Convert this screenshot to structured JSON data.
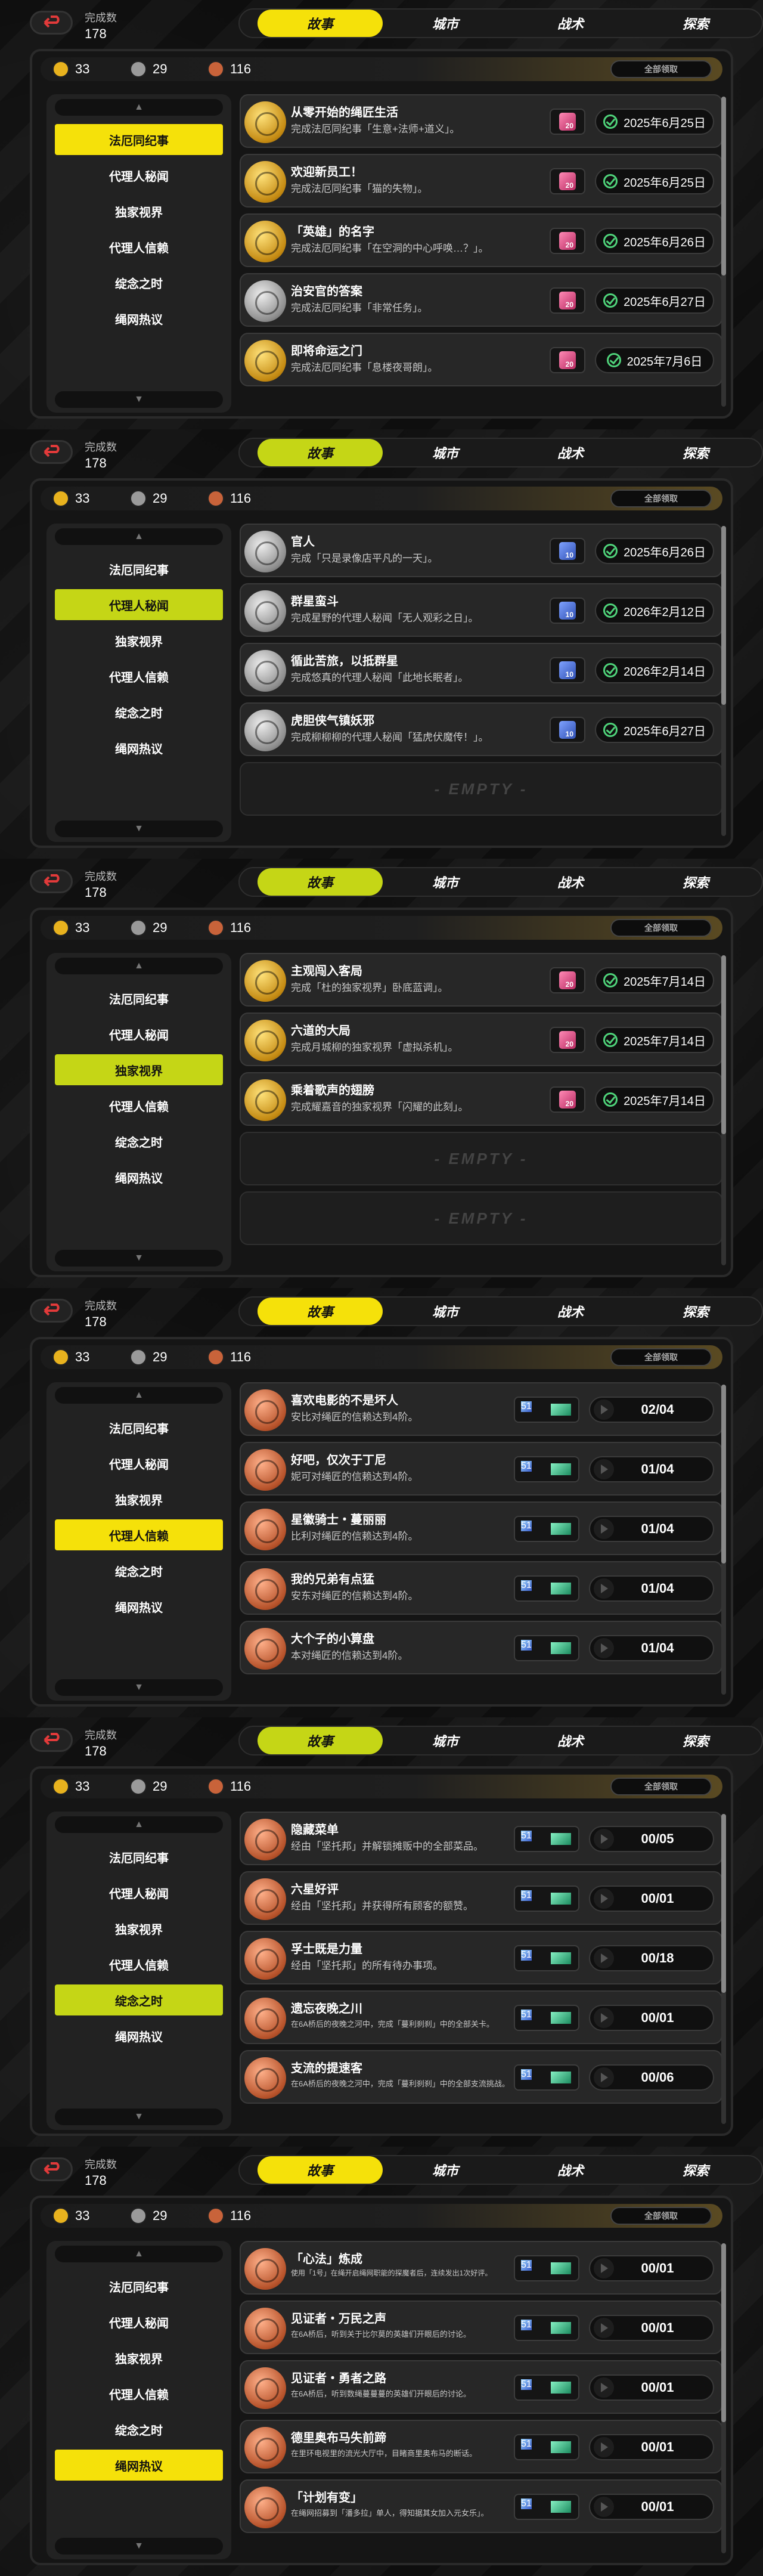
{
  "accent": "#f5e10a",
  "accent_alt": "#c5d616",
  "completion": {
    "label": "完成数",
    "value": "178"
  },
  "tabs": [
    "故事",
    "城市",
    "战术",
    "探索"
  ],
  "currencies": [
    {
      "icon": "gold-coin-icon",
      "value": "33",
      "color": "#e8b21e"
    },
    {
      "icon": "silver-coin-icon",
      "value": "29",
      "color": "#9a9a9a"
    },
    {
      "icon": "bronze-coin-icon",
      "value": "116",
      "color": "#c8633a"
    }
  ],
  "claim_all": "全部领取",
  "categories": [
    "法厄同纪事",
    "代理人秘闻",
    "独家视界",
    "代理人信赖",
    "绽念之时",
    "绳网热议"
  ],
  "empty_label": "- EMPTY -",
  "panels": [
    {
      "active_category": 0,
      "rows": [
        {
          "title": "从零开始的绳匠生活",
          "desc": "完成法厄同纪事「生意+法师+道义」。",
          "badge": "gold",
          "reward": "20",
          "chip": "pink",
          "status": "2025年6月25日"
        },
        {
          "title": "欢迎新员工！",
          "desc": "完成法厄同纪事「猫的失物」。",
          "badge": "gold",
          "reward": "20",
          "chip": "pink",
          "status": "2025年6月25日"
        },
        {
          "title": "「英雄」的名字",
          "desc": "完成法厄同纪事「在空洞的中心呼唤…？」。",
          "badge": "gold",
          "reward": "20",
          "chip": "pink",
          "status": "2025年6月26日"
        },
        {
          "title": "治安官的答案",
          "desc": "完成法厄同纪事「非常任务」。",
          "badge": "silver",
          "reward": "20",
          "chip": "pink",
          "status": "2025年6月27日"
        },
        {
          "title": "即将命运之门",
          "desc": "完成法厄同纪事「息楼夜哥朗」。",
          "badge": "gold",
          "reward": "20",
          "chip": "pink",
          "status": "2025年7月6日"
        }
      ]
    },
    {
      "active_category": 1,
      "rows": [
        {
          "title": "官人",
          "desc": "完成「只是录像店平凡的一天」。",
          "badge": "silver",
          "reward": "10",
          "chip": "blue",
          "status": "2025年6月26日"
        },
        {
          "title": "群星蛮斗",
          "desc": "完成星野的代理人秘闻「无人观彩之日」。",
          "badge": "silver",
          "reward": "10",
          "chip": "blue",
          "status": "2026年2月12日"
        },
        {
          "title": "循此苦旅，以抵群星",
          "desc": "完成悠真的代理人秘闻「此地长眠者」。",
          "badge": "silver",
          "reward": "10",
          "chip": "blue",
          "status": "2026年2月14日"
        },
        {
          "title": "虎胆侠气镇妖邪",
          "desc": "完成柳柳柳的代理人秘闻「猛虎伏魔传！」。",
          "badge": "silver",
          "reward": "10",
          "chip": "blue",
          "status": "2025年6月27日"
        }
      ],
      "empties": 1
    },
    {
      "active_category": 2,
      "rows": [
        {
          "title": "主观闯入客局",
          "desc": "完成「杜的独家视界」卧底蓝调」。",
          "badge": "gold",
          "reward": "20",
          "chip": "pink",
          "status": "2025年7月14日"
        },
        {
          "title": "六道的大局",
          "desc": "完成月城柳的独家视界「虚拟杀机」。",
          "badge": "gold",
          "reward": "20",
          "chip": "pink",
          "status": "2025年7月14日"
        },
        {
          "title": "乘着歌声的翅膀",
          "desc": "完成耀嘉音的独家视界「闪耀的此刻」。",
          "badge": "gold",
          "reward": "20",
          "chip": "pink",
          "status": "2025年7月14日"
        }
      ],
      "empties": 2
    },
    {
      "active_category": 3,
      "rows": [
        {
          "title": "喜欢电影的不是坏人",
          "desc": "安比对绳匠的信赖达到4阶。",
          "badge": "bronze",
          "reward": "51",
          "progress": "02/04"
        },
        {
          "title": "好吧，仅次于丁尼",
          "desc": "妮可对绳匠的信赖达到4阶。",
          "badge": "bronze",
          "reward": "51",
          "progress": "01/04"
        },
        {
          "title": "星徽骑士・蔓丽丽",
          "desc": "比利对绳匠的信赖达到4阶。",
          "badge": "bronze",
          "reward": "51",
          "progress": "01/04"
        },
        {
          "title": "我的兄弟有点猛",
          "desc": "安东对绳匠的信赖达到4阶。",
          "badge": "bronze",
          "reward": "51",
          "progress": "01/04"
        },
        {
          "title": "大个子的小算盘",
          "desc": "本对绳匠的信赖达到4阶。",
          "badge": "bronze",
          "reward": "51",
          "progress": "01/04"
        }
      ]
    },
    {
      "active_category": 4,
      "rows": [
        {
          "title": "隐藏菜单",
          "desc": "经由「坚托邦」并解锁摊贩中的全部菜品。",
          "badge": "bronze",
          "reward": "51",
          "progress": "00/05"
        },
        {
          "title": "六星好评",
          "desc": "经由「坚托邦」并获得所有顾客的额赞。",
          "badge": "bronze",
          "reward": "51",
          "progress": "00/01"
        },
        {
          "title": "孚士既是力量",
          "desc": "经由「坚托邦」的所有待办事项。",
          "badge": "bronze",
          "reward": "51",
          "progress": "00/18"
        },
        {
          "title": "遗忘夜晚之川",
          "desc": "在6A桥后的夜晚之河中，完成「蔓利刹刹」中的全部关卡。",
          "badge": "bronze",
          "reward": "51",
          "progress": "00/01",
          "small": true
        },
        {
          "title": "支流的提速客",
          "desc": "在6A桥后的夜晚之河中，完成「蔓利刹刹」中的全部支流挑战。",
          "badge": "bronze",
          "reward": "51",
          "progress": "00/06",
          "small": true
        }
      ]
    },
    {
      "active_category": 5,
      "rows": [
        {
          "title": "「心法」炼成",
          "desc": "使用「1号」在绳开启绳网职能的探魔者后，连续发出1次好评。",
          "badge": "bronze",
          "reward": "51",
          "progress": "00/01",
          "tiny": true
        },
        {
          "title": "见证者・万民之声",
          "desc": "在6A桥后，听到关于比尔莫的英雄们开眼后的讨论。",
          "badge": "bronze",
          "reward": "51",
          "progress": "00/01",
          "small": true
        },
        {
          "title": "见证者・勇者之路",
          "desc": "在6A桥后，听到数绳蔓蔓蔓的英雄们开眼后的讨论。",
          "badge": "bronze",
          "reward": "51",
          "progress": "00/01",
          "small": true
        },
        {
          "title": "德里奥布马失前蹄",
          "desc": "在里环电视里的流光大厅中，目睹商里奥布马的断话。",
          "badge": "bronze",
          "reward": "51",
          "progress": "00/01",
          "small": true
        },
        {
          "title": "「计划有变」",
          "desc": "在绳网招募到「潘多拉」单人，得知据其女加入元女乐」。",
          "badge": "bronze",
          "reward": "51",
          "progress": "00/01",
          "small": true
        }
      ]
    }
  ]
}
